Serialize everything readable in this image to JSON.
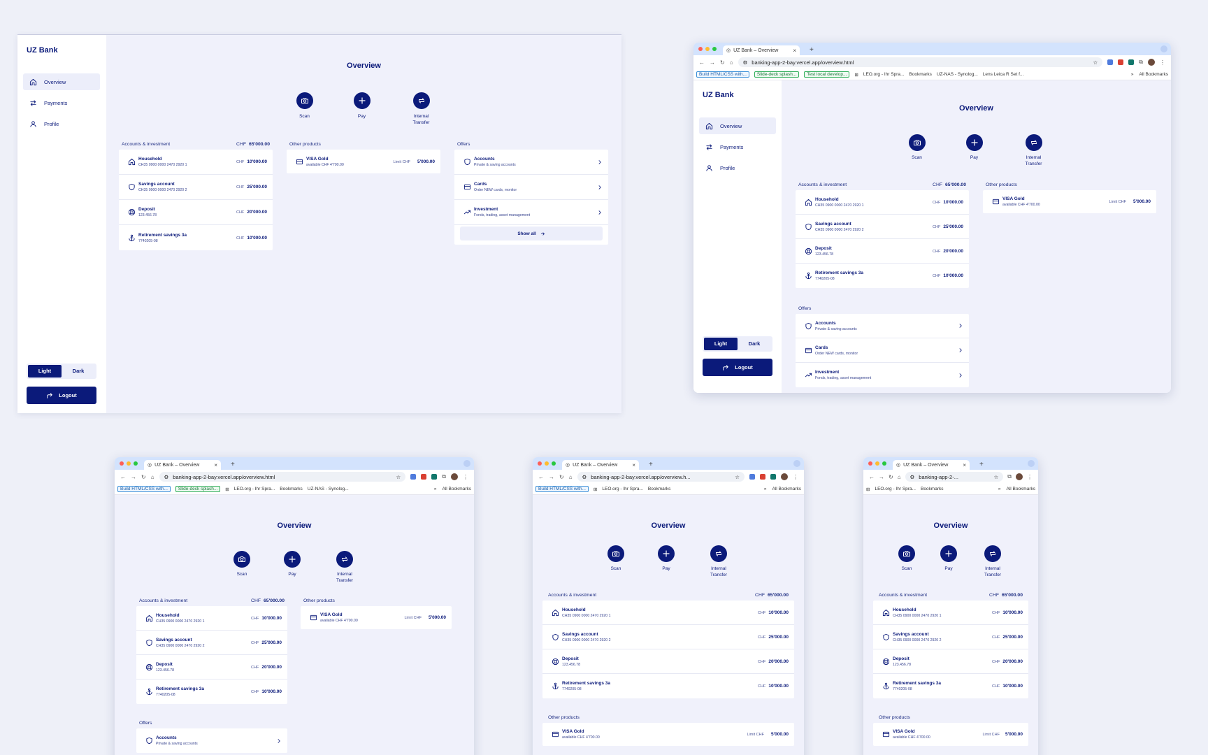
{
  "app": {
    "brand": "UZ Bank",
    "page_title": "Overview",
    "nav": [
      {
        "label": "Overview"
      },
      {
        "label": "Payments"
      },
      {
        "label": "Profile"
      }
    ],
    "theme": {
      "light": "Light",
      "dark": "Dark"
    },
    "logout": "Logout",
    "actions": {
      "scan": "Scan",
      "pay": "Pay",
      "transfer_1": "Internal",
      "transfer_2": "Transfer"
    },
    "accounts": {
      "title": "Accounts & investment",
      "currency": "CHF",
      "total": "65'000.00",
      "items": [
        {
          "name": "Household",
          "sub": "CH35 0900 0000 2470 2920 1",
          "currency": "CHF",
          "amount": "10'000.00"
        },
        {
          "name": "Savings account",
          "sub": "CH35 0900 0000 2470 2920 2",
          "currency": "CHF",
          "amount": "25'000.00"
        },
        {
          "name": "Deposit",
          "sub": "123.456.78",
          "currency": "CHF",
          "amount": "20'000.00"
        },
        {
          "name": "Retirement savings 3a",
          "sub": "7740205-08",
          "currency": "CHF",
          "amount": "10'000.00"
        }
      ]
    },
    "other_products": {
      "title": "Other products",
      "items": [
        {
          "name": "VISA Gold",
          "sub": "available CHF 4'700.00",
          "limit_label": "Limit CHF",
          "amount": "5'000.00"
        }
      ]
    },
    "offers": {
      "title": "Offers",
      "items": [
        {
          "name": "Accounts",
          "sub": "Private & saving accounts"
        },
        {
          "name": "Cards",
          "sub": "Order NEW cards, monitor"
        },
        {
          "name": "Investment",
          "sub": "Fonds, trading, asset management"
        }
      ],
      "show_all": "Show all"
    }
  },
  "browser": {
    "tab_title": "UZ Bank – Overview",
    "url": "banking-app-2-bay.vercel.app/overview.html",
    "url_medium": "banking-app-2-bay.vercel.app/overview.h...",
    "url_short": "banking-app-2-...",
    "bookmarks": {
      "build": "Build HTML/CSS with...",
      "slide": "Slide-deck splash...",
      "test": "Test local develop...",
      "leo": "LEO.org - Ihr Spra...",
      "bookmarks": "Bookmarks",
      "nas": "UZ-NAS - Synolog...",
      "lens": "Lens Leica R Set f...",
      "all": "All Bookmarks"
    }
  },
  "colors": {
    "navy": "#0b1a7a",
    "bg": "#f0f1fb",
    "tabbar": "#d3e3fd"
  }
}
